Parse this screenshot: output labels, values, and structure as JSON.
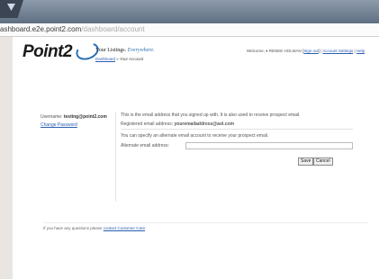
{
  "browser": {
    "address_domain": "ashboard.e2e.point2.com",
    "address_path": "/dashboard/account"
  },
  "header": {
    "logo_text": "Point",
    "logo_number": "2",
    "tagline_plain": "Your Listings. ",
    "tagline_em": "Everywhere.",
    "breadcrumb_link": "Dashboard",
    "breadcrumb_sep": " » ",
    "breadcrumb_current": "Your Account",
    "welcome": "Welcome, ♦ RENEE HOLMAN [",
    "sign_out": "Sign out",
    "sep_a": "] | ",
    "account_settings": "Account Settings",
    "sep_b": " | ",
    "help": "Help"
  },
  "user": {
    "username_label": "Username: ",
    "username_value": "testing@point2.com",
    "change_password": "Change Password"
  },
  "email": {
    "info": "This is the email address that you signed up with. It is also used to receive prospect email.",
    "registered_label": "Registered email address: ",
    "registered_value": "youremailaddress@aol.com",
    "alt_info": "You can specify an alternate email account to receive your prospect email.",
    "alt_label": "Alternate email address:",
    "alt_value": "",
    "save": "Save",
    "cancel": "Cancel"
  },
  "footer": {
    "text": "If you have any questions please ",
    "link": "contact Customer Care",
    "end": "."
  }
}
